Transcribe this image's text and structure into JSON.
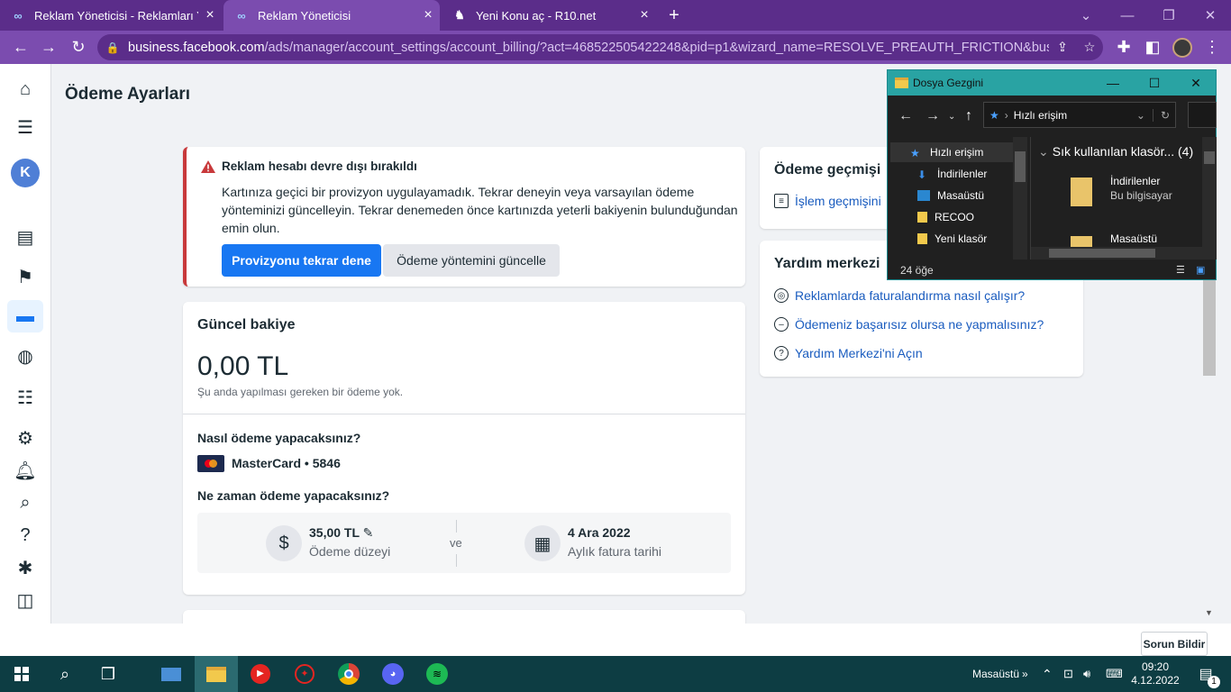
{
  "browser": {
    "tabs": [
      {
        "title": "Reklam Yöneticisi - Reklamları Yö",
        "active": false,
        "icon": "meta-icon"
      },
      {
        "title": "Reklam Yöneticisi",
        "active": true,
        "icon": "meta-icon"
      },
      {
        "title": "Yeni Konu aç - R10.net",
        "active": false,
        "icon": "r10-icon"
      }
    ],
    "new_tab": "+",
    "url_host": "business.facebook.com",
    "url_path": "/ads/manager/account_settings/account_billing/?act=468522505422248&pid=p1&wizard_name=RESOLVE_PREAUTH_FRICTION&business_i..."
  },
  "page": {
    "title": "Ödeme Ayarları",
    "avatar_letter": "K"
  },
  "alert": {
    "title": "Reklam hesabı devre dışı bırakıldı",
    "message": "Kartınıza geçici bir provizyon uygulayamadık. Tekrar deneyin veya varsayılan ödeme yönteminizi güncelleyin. Tekrar denemeden önce kartınızda yeterli bakiyenin bulunduğundan emin olun.",
    "retry_label": "Provizyonu tekrar dene",
    "update_label": "Ödeme yöntemini güncelle"
  },
  "balance": {
    "heading": "Güncel bakiye",
    "amount": "0,00 TL",
    "note": "Şu anda yapılması gereken bir ödeme yok.",
    "how_q": "Nasıl ödeme yapacaksınız?",
    "card": "MasterCard • 5846",
    "when_q": "Ne zaman ödeme yapacaksınız?",
    "threshold_value": "35,00 TL",
    "threshold_label": "Ödeme düzeyi",
    "and": "ve",
    "date_value": "4 Ara 2022",
    "date_label": "Aylık fatura tarihi"
  },
  "history": {
    "heading": "Ödeme geçmişi",
    "link": "İşlem geçmişini"
  },
  "help": {
    "heading": "Yardım merkezi",
    "links": [
      "Reklamlarda faturalandırma nasıl çalışır?",
      "Ödemeniz başarısız olursa ne yapmalısınız?",
      "Yardım Merkezi'ni Açın"
    ]
  },
  "report_button": "Sorun Bildir",
  "explorer": {
    "title": "Dosya Gezgini",
    "address": "Hızlı erişim",
    "tree": [
      "Hızlı erişim",
      "İndirilenler",
      "Masaüstü",
      "RECOO",
      "Yeni klasör"
    ],
    "group": "Sık kullanılan klasör... (4)",
    "items": [
      {
        "name": "İndirilenler",
        "sub": "Bu bilgisayar"
      },
      {
        "name": "Masaüstü",
        "sub": ""
      }
    ],
    "status": "24 öğe"
  },
  "taskbar": {
    "desktop_label": "Masaüstü",
    "time": "09:20",
    "date": "4.12.2022",
    "notif_count": "1"
  },
  "colors": {
    "browser_frame": "#5b2d8a",
    "primary_button": "#1877f2",
    "alert_red": "#c8393b",
    "link": "#1a5cbf",
    "explorer_title": "#29a3a3",
    "taskbar": "#0d3d43"
  }
}
